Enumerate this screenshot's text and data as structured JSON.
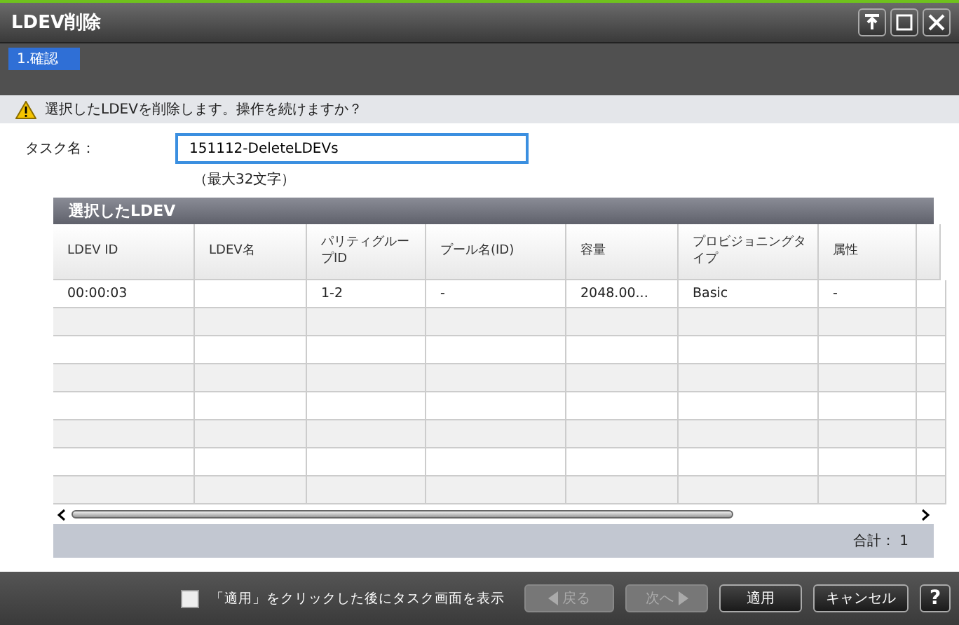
{
  "window": {
    "title": "LDEV削除"
  },
  "steps": [
    {
      "label": "1.確認",
      "selected": true
    }
  ],
  "warning": "選択したLDEVを削除します。操作を続けますか？",
  "task": {
    "label": "タスク名：",
    "value": "151112-DeleteLDEVs",
    "hint": "（最大32文字）"
  },
  "table": {
    "title": "選択したLDEV",
    "columns": [
      "LDEV ID",
      "LDEV名",
      "パリティグループID",
      "プール名(ID)",
      "容量",
      "プロビジョニングタイプ",
      "属性"
    ],
    "rows": [
      [
        "00:00:03",
        "",
        "1-2",
        "-",
        "2048.00...",
        "Basic",
        "-"
      ]
    ],
    "total": "合計： 1"
  },
  "footer": {
    "checkbox": {
      "label": "「適用」をクリックした後にタスク画面を表示",
      "checked": false
    },
    "buttons": [
      {
        "label": "戻る",
        "kind": "back",
        "disabled": true
      },
      {
        "label": "次へ",
        "kind": "next",
        "disabled": true
      },
      {
        "label": "適用",
        "kind": "plain",
        "disabled": false
      },
      {
        "label": "キャンセル",
        "kind": "plain",
        "disabled": false
      },
      {
        "label": "?",
        "kind": "help",
        "disabled": false
      }
    ]
  }
}
